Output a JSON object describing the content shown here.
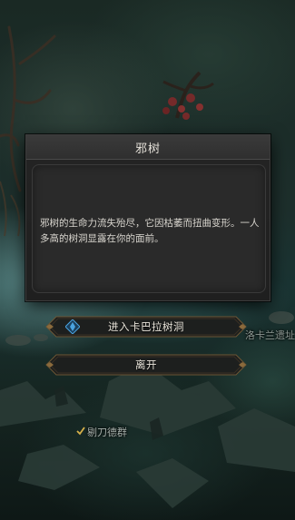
{
  "dialog": {
    "title": "邪树",
    "description": "邪树的生命力流失殆尽，它因枯萎而扭曲变形。一人多高的树洞显露在你的面前。"
  },
  "actions": {
    "enter_label": "进入卡巴拉树洞",
    "leave_label": "离开"
  },
  "map": {
    "location_left": "剔刀德群",
    "location_right": "洛卡兰遗址"
  },
  "colors": {
    "dialog_bg": "#242424",
    "button_border": "#8a6a3c",
    "icon_blue": "#4aa3e0",
    "marker_gold": "#d6b04a"
  },
  "icons": {
    "enter_icon": "compass-icon",
    "location_icon": "location-check-icon"
  }
}
